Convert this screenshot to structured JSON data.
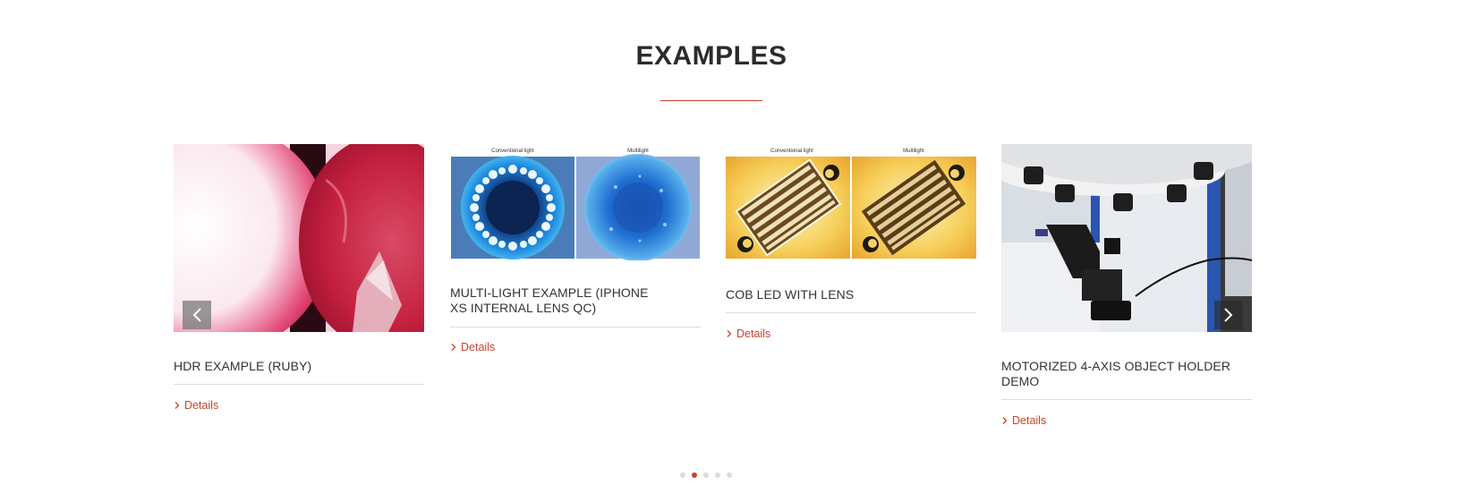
{
  "section": {
    "title": "EXAMPLES"
  },
  "cards": [
    {
      "title": "HDR EXAMPLE (RUBY)",
      "link_label": "Details"
    },
    {
      "title": "MULTI-LIGHT EXAMPLE (IPHONE XS INTERNAL LENS QC)",
      "link_label": "Details",
      "image_labels": {
        "left": "Conventional light",
        "right": "Multilight"
      }
    },
    {
      "title": "COB LED WITH LENS",
      "link_label": "Details",
      "image_labels": {
        "left": "Conventional light",
        "right": "Multilight"
      }
    },
    {
      "title": "MOTORIZED 4-AXIS OBJECT HOLDER DEMO",
      "link_label": "Details"
    }
  ],
  "carousel": {
    "prev_icon": "chevron-left-icon",
    "next_icon": "chevron-right-icon",
    "dot_count": 5,
    "active_dot": 2
  },
  "colors": {
    "accent": "#c9432b",
    "divider": "#dddddd",
    "text": "#333333"
  }
}
